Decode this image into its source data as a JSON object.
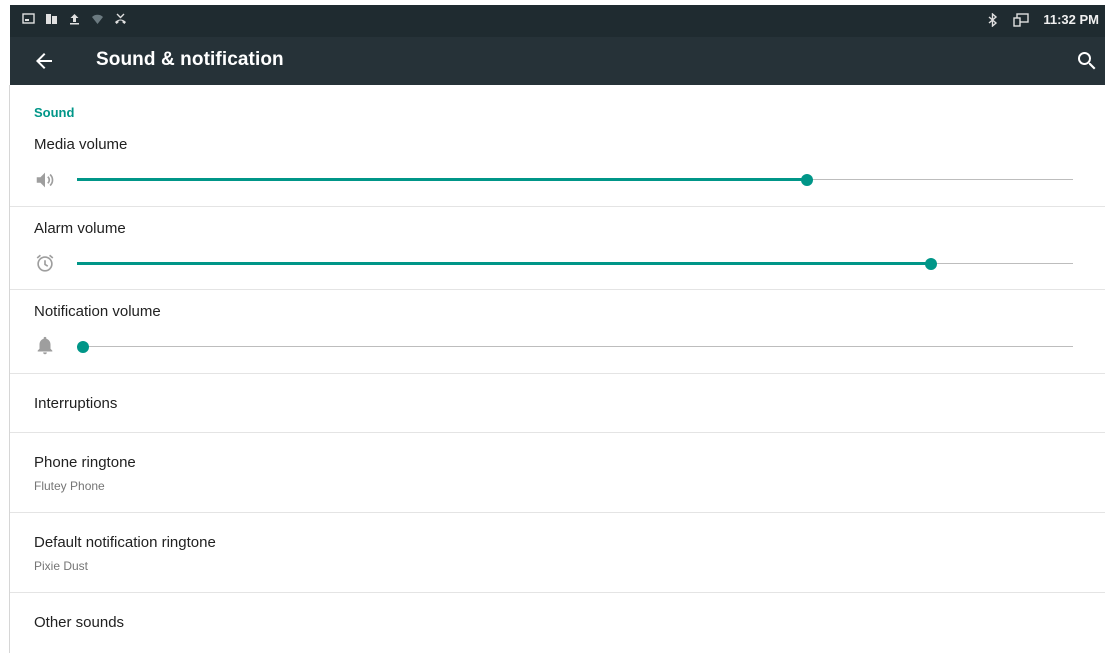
{
  "status_bar": {
    "time": "11:32 PM",
    "left_icons": [
      "screenshot-icon",
      "usb-icon",
      "upload-icon",
      "wifi-icon",
      "missed-call-icon"
    ],
    "right_icons": [
      "bluetooth-icon",
      "cast-icon"
    ]
  },
  "app_bar": {
    "title": "Sound & notification",
    "back_icon": "arrow-back-icon",
    "search_icon": "search-icon"
  },
  "sections": {
    "sound_header": "Sound"
  },
  "volumes": [
    {
      "label": "Media volume",
      "icon": "speaker-icon",
      "level": 0.733
    },
    {
      "label": "Alarm volume",
      "icon": "alarm-clock-icon",
      "level": 0.857
    },
    {
      "label": "Notification volume",
      "icon": "bell-icon",
      "level": 0.0
    }
  ],
  "items": {
    "interruptions": {
      "title": "Interruptions"
    },
    "phone_ringtone": {
      "title": "Phone ringtone",
      "summary": "Flutey Phone"
    },
    "default_notification_ringtone": {
      "title": "Default notification ringtone",
      "summary": "Pixie Dust"
    },
    "other_sounds": {
      "title": "Other sounds"
    }
  },
  "colors": {
    "accent": "#009688",
    "status_bar": "#1f2b30",
    "app_bar": "#263238",
    "track": "#bdbdbd"
  }
}
